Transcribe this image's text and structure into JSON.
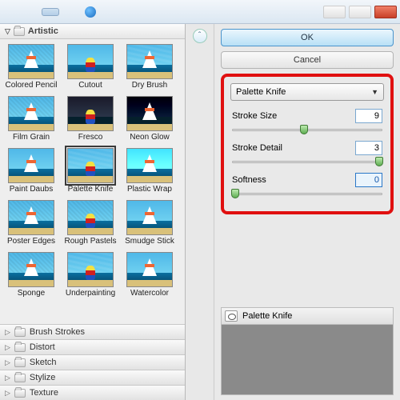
{
  "menubar": {
    "items": [
      "",
      "",
      "",
      ""
    ],
    "activeIndex": 2
  },
  "category_open": "Artistic",
  "filters": [
    {
      "label": "Colored Pencil",
      "variant": "fx-grain"
    },
    {
      "label": "Cutout",
      "variant": ""
    },
    {
      "label": "Dry Brush",
      "variant": "fx-knife"
    },
    {
      "label": "Film Grain",
      "variant": "fx-grain"
    },
    {
      "label": "Fresco",
      "variant": "dark"
    },
    {
      "label": "Neon Glow",
      "variant": "dark fx-plastic"
    },
    {
      "label": "Paint Daubs",
      "variant": ""
    },
    {
      "label": "Palette Knife",
      "variant": "fx-knife",
      "selected": true
    },
    {
      "label": "Plastic Wrap",
      "variant": "fx-plastic"
    },
    {
      "label": "Poster Edges",
      "variant": "fx-edges"
    },
    {
      "label": "Rough Pastels",
      "variant": "fx-grain"
    },
    {
      "label": "Smudge Stick",
      "variant": ""
    },
    {
      "label": "Sponge",
      "variant": "fx-sponge"
    },
    {
      "label": "Underpainting",
      "variant": "fx-knife"
    },
    {
      "label": "Watercolor",
      "variant": ""
    }
  ],
  "categories": [
    "Brush Strokes",
    "Distort",
    "Sketch",
    "Stylize",
    "Texture"
  ],
  "buttons": {
    "ok": "OK",
    "cancel": "Cancel"
  },
  "collapse_glyph": "ˆ",
  "dropdown": {
    "value": "Palette Knife"
  },
  "params": [
    {
      "name": "Stroke Size",
      "value": "9",
      "pos": 48
    },
    {
      "name": "Stroke Detail",
      "value": "3",
      "pos": 98
    },
    {
      "name": "Softness",
      "value": "0",
      "pos": 2,
      "active": true
    }
  ],
  "layer": {
    "name": "Palette Knife"
  }
}
